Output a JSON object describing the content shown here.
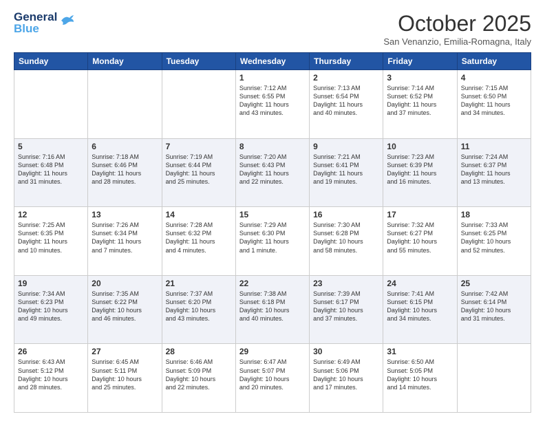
{
  "logo": {
    "line1": "General",
    "line2": "Blue"
  },
  "header": {
    "month": "October 2025",
    "location": "San Venanzio, Emilia-Romagna, Italy"
  },
  "weekdays": [
    "Sunday",
    "Monday",
    "Tuesday",
    "Wednesday",
    "Thursday",
    "Friday",
    "Saturday"
  ],
  "weeks": [
    [
      {
        "day": "",
        "info": ""
      },
      {
        "day": "",
        "info": ""
      },
      {
        "day": "",
        "info": ""
      },
      {
        "day": "1",
        "info": "Sunrise: 7:12 AM\nSunset: 6:55 PM\nDaylight: 11 hours\nand 43 minutes."
      },
      {
        "day": "2",
        "info": "Sunrise: 7:13 AM\nSunset: 6:54 PM\nDaylight: 11 hours\nand 40 minutes."
      },
      {
        "day": "3",
        "info": "Sunrise: 7:14 AM\nSunset: 6:52 PM\nDaylight: 11 hours\nand 37 minutes."
      },
      {
        "day": "4",
        "info": "Sunrise: 7:15 AM\nSunset: 6:50 PM\nDaylight: 11 hours\nand 34 minutes."
      }
    ],
    [
      {
        "day": "5",
        "info": "Sunrise: 7:16 AM\nSunset: 6:48 PM\nDaylight: 11 hours\nand 31 minutes."
      },
      {
        "day": "6",
        "info": "Sunrise: 7:18 AM\nSunset: 6:46 PM\nDaylight: 11 hours\nand 28 minutes."
      },
      {
        "day": "7",
        "info": "Sunrise: 7:19 AM\nSunset: 6:44 PM\nDaylight: 11 hours\nand 25 minutes."
      },
      {
        "day": "8",
        "info": "Sunrise: 7:20 AM\nSunset: 6:43 PM\nDaylight: 11 hours\nand 22 minutes."
      },
      {
        "day": "9",
        "info": "Sunrise: 7:21 AM\nSunset: 6:41 PM\nDaylight: 11 hours\nand 19 minutes."
      },
      {
        "day": "10",
        "info": "Sunrise: 7:23 AM\nSunset: 6:39 PM\nDaylight: 11 hours\nand 16 minutes."
      },
      {
        "day": "11",
        "info": "Sunrise: 7:24 AM\nSunset: 6:37 PM\nDaylight: 11 hours\nand 13 minutes."
      }
    ],
    [
      {
        "day": "12",
        "info": "Sunrise: 7:25 AM\nSunset: 6:35 PM\nDaylight: 11 hours\nand 10 minutes."
      },
      {
        "day": "13",
        "info": "Sunrise: 7:26 AM\nSunset: 6:34 PM\nDaylight: 11 hours\nand 7 minutes."
      },
      {
        "day": "14",
        "info": "Sunrise: 7:28 AM\nSunset: 6:32 PM\nDaylight: 11 hours\nand 4 minutes."
      },
      {
        "day": "15",
        "info": "Sunrise: 7:29 AM\nSunset: 6:30 PM\nDaylight: 11 hours\nand 1 minute."
      },
      {
        "day": "16",
        "info": "Sunrise: 7:30 AM\nSunset: 6:28 PM\nDaylight: 10 hours\nand 58 minutes."
      },
      {
        "day": "17",
        "info": "Sunrise: 7:32 AM\nSunset: 6:27 PM\nDaylight: 10 hours\nand 55 minutes."
      },
      {
        "day": "18",
        "info": "Sunrise: 7:33 AM\nSunset: 6:25 PM\nDaylight: 10 hours\nand 52 minutes."
      }
    ],
    [
      {
        "day": "19",
        "info": "Sunrise: 7:34 AM\nSunset: 6:23 PM\nDaylight: 10 hours\nand 49 minutes."
      },
      {
        "day": "20",
        "info": "Sunrise: 7:35 AM\nSunset: 6:22 PM\nDaylight: 10 hours\nand 46 minutes."
      },
      {
        "day": "21",
        "info": "Sunrise: 7:37 AM\nSunset: 6:20 PM\nDaylight: 10 hours\nand 43 minutes."
      },
      {
        "day": "22",
        "info": "Sunrise: 7:38 AM\nSunset: 6:18 PM\nDaylight: 10 hours\nand 40 minutes."
      },
      {
        "day": "23",
        "info": "Sunrise: 7:39 AM\nSunset: 6:17 PM\nDaylight: 10 hours\nand 37 minutes."
      },
      {
        "day": "24",
        "info": "Sunrise: 7:41 AM\nSunset: 6:15 PM\nDaylight: 10 hours\nand 34 minutes."
      },
      {
        "day": "25",
        "info": "Sunrise: 7:42 AM\nSunset: 6:14 PM\nDaylight: 10 hours\nand 31 minutes."
      }
    ],
    [
      {
        "day": "26",
        "info": "Sunrise: 6:43 AM\nSunset: 5:12 PM\nDaylight: 10 hours\nand 28 minutes."
      },
      {
        "day": "27",
        "info": "Sunrise: 6:45 AM\nSunset: 5:11 PM\nDaylight: 10 hours\nand 25 minutes."
      },
      {
        "day": "28",
        "info": "Sunrise: 6:46 AM\nSunset: 5:09 PM\nDaylight: 10 hours\nand 22 minutes."
      },
      {
        "day": "29",
        "info": "Sunrise: 6:47 AM\nSunset: 5:07 PM\nDaylight: 10 hours\nand 20 minutes."
      },
      {
        "day": "30",
        "info": "Sunrise: 6:49 AM\nSunset: 5:06 PM\nDaylight: 10 hours\nand 17 minutes."
      },
      {
        "day": "31",
        "info": "Sunrise: 6:50 AM\nSunset: 5:05 PM\nDaylight: 10 hours\nand 14 minutes."
      },
      {
        "day": "",
        "info": ""
      }
    ]
  ]
}
